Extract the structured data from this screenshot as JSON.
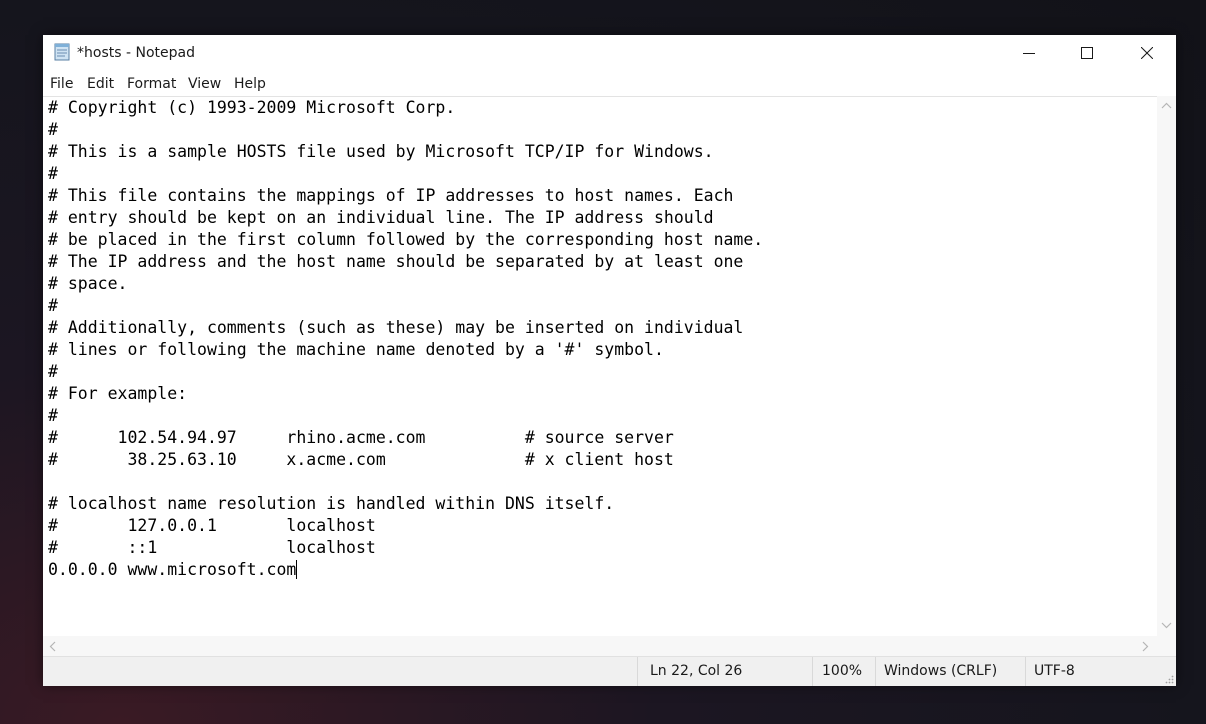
{
  "window": {
    "title": "*hosts - Notepad",
    "icon": "notepad-icon"
  },
  "menu": {
    "file": "File",
    "edit": "Edit",
    "format": "Format",
    "view": "View",
    "help": "Help"
  },
  "editor": {
    "content": "# Copyright (c) 1993-2009 Microsoft Corp.\n#\n# This is a sample HOSTS file used by Microsoft TCP/IP for Windows.\n#\n# This file contains the mappings of IP addresses to host names. Each\n# entry should be kept on an individual line. The IP address should\n# be placed in the first column followed by the corresponding host name.\n# The IP address and the host name should be separated by at least one\n# space.\n#\n# Additionally, comments (such as these) may be inserted on individual\n# lines or following the machine name denoted by a '#' symbol.\n#\n# For example:\n#\n#      102.54.94.97     rhino.acme.com          # source server\n#       38.25.63.10     x.acme.com              # x client host\n\n# localhost name resolution is handled within DNS itself.\n#       127.0.0.1       localhost\n#       ::1             localhost\n0.0.0.0 www.microsoft.com"
  },
  "status": {
    "position": "Ln 22, Col 26",
    "zoom": "100%",
    "line_ending": "Windows (CRLF)",
    "encoding": "UTF-8"
  },
  "colors": {
    "window_bg": "#ffffff",
    "statusbar_bg": "#f0f0f0",
    "text": "#000000"
  }
}
